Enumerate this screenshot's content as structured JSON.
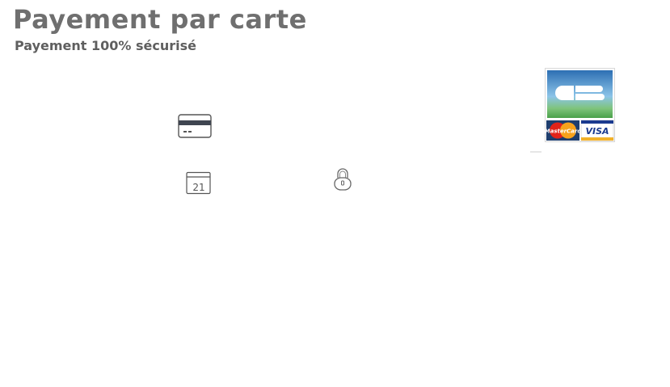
{
  "header": {
    "title": "Payement par carte",
    "subtitle": "Payement 100% sécurisé"
  },
  "form_icons": {
    "card_icon": "credit-card-icon",
    "calendar_icon": "calendar-icon",
    "calendar_day": "21",
    "lock_icon": "lock-icon"
  },
  "payment_logos": {
    "cb": "CB",
    "mastercard": "MasterCard",
    "visa": "VISA"
  },
  "colors": {
    "title": "#6f6f6f",
    "icon_stroke": "#555555",
    "cb_top": "#2d6fb3",
    "cb_bottom": "#4aa04a",
    "visa_blue": "#1a3a8f",
    "visa_gold": "#f2b12a",
    "mc_red": "#e2231a",
    "mc_yellow": "#f7a21b"
  }
}
